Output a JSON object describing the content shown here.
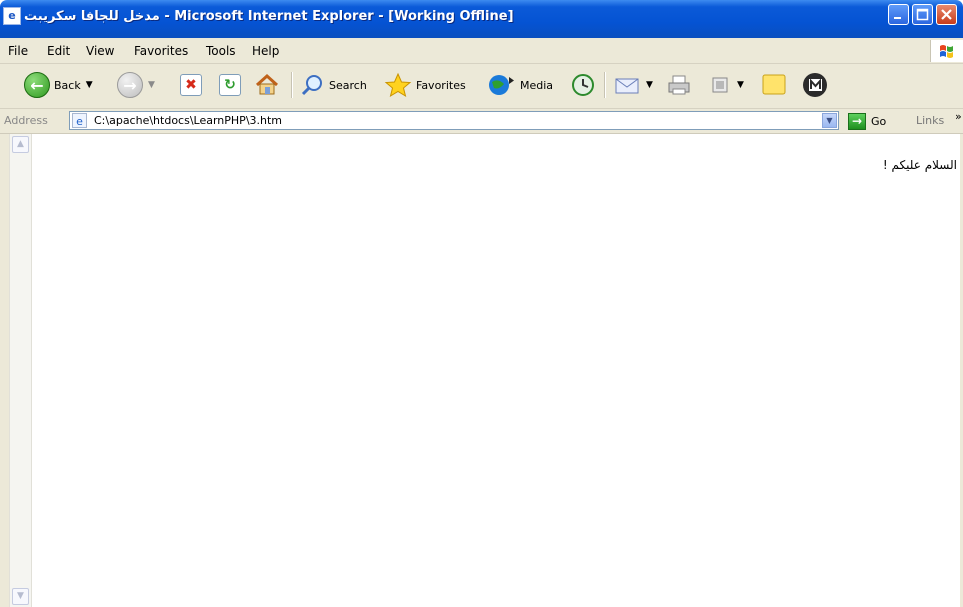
{
  "window": {
    "title": "مدخل للجافا سكريبت - Microsoft Internet Explorer - [Working Offline]",
    "colors": {
      "titlebar": "#0553d3",
      "chrome": "#ece9d8",
      "close": "#c83c1c"
    }
  },
  "menu": {
    "items": [
      "File",
      "Edit",
      "View",
      "Favorites",
      "Tools",
      "Help"
    ]
  },
  "toolbar": {
    "back_label": "Back",
    "search_label": "Search",
    "favorites_label": "Favorites",
    "media_label": "Media"
  },
  "address": {
    "label": "Address",
    "value": "C:\\apache\\htdocs\\LearnPHP\\3.htm",
    "go_label": "Go",
    "links_label": "Links"
  },
  "page": {
    "text": "السلام عليكم !"
  }
}
